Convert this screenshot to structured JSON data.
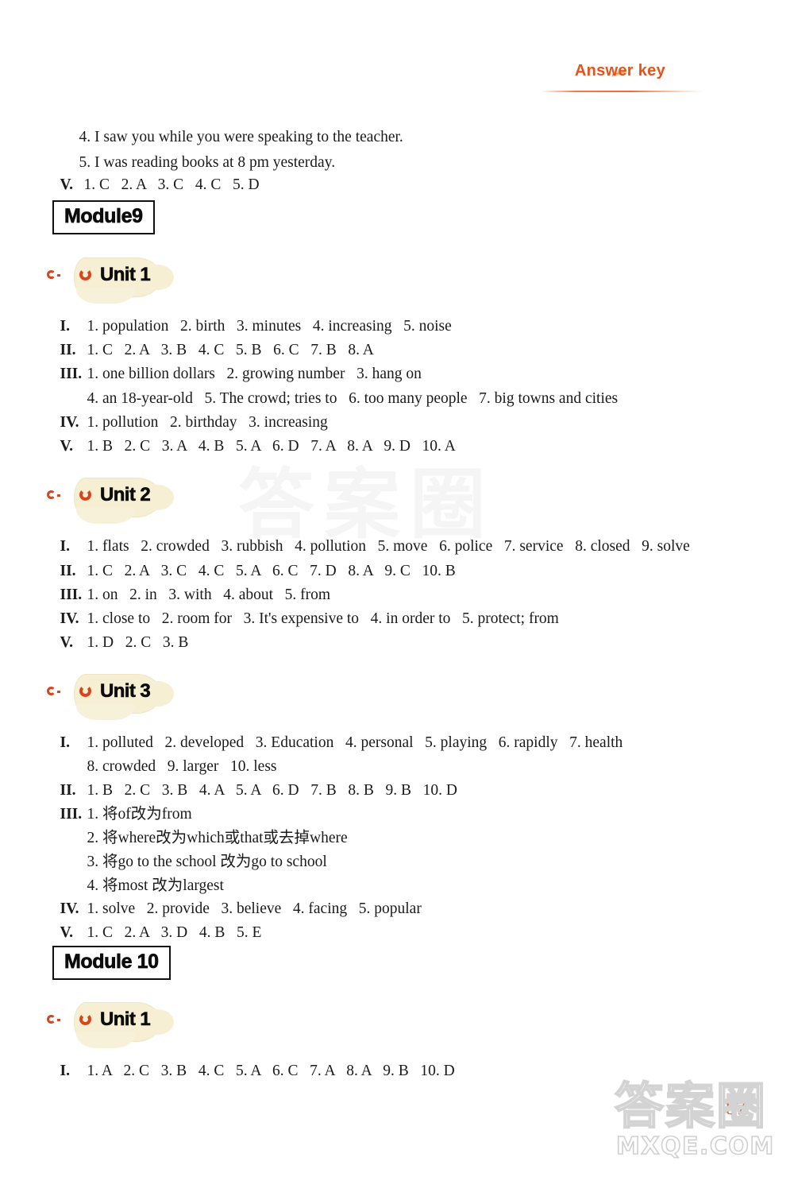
{
  "header": {
    "title": "Answer key",
    "accent_color": "#e8521a"
  },
  "page_number": "87",
  "watermark": {
    "center_text": "答案圈",
    "brand_cn": "答案圈",
    "brand_url": "MXQE.COM"
  },
  "content": {
    "intro_lines": [
      {
        "text": "4. I saw you while you were speaking to the teacher."
      },
      {
        "text": "5. I was reading books at 8 pm yesterday."
      }
    ],
    "intro_answer": {
      "roman": "V.",
      "text": "1. C   2. A   3. C   4. C   5. D"
    },
    "modules": [
      {
        "title": "Module9",
        "units": [
          {
            "label": "Unit 1",
            "rows": [
              {
                "roman": "I.",
                "text": "1. population   2. birth   3. minutes   4. increasing   5. noise"
              },
              {
                "roman": "II.",
                "text": "1. C   2. A   3. B   4. C   5. B   6. C   7. B   8. A"
              },
              {
                "roman": "III.",
                "text": "1. one billion dollars   2. growing number   3. hang on"
              },
              {
                "roman": "",
                "text": "4. an 18-year-old   5. The crowd; tries to   6. too many people   7. big towns and cities",
                "indent": true
              },
              {
                "roman": "IV.",
                "text": "1. pollution   2. birthday   3. increasing"
              },
              {
                "roman": "V.",
                "text": "1. B   2. C   3. A   4. B   5. A   6. D   7. A   8. A   9. D   10. A"
              }
            ]
          },
          {
            "label": "Unit 2",
            "rows": [
              {
                "roman": "I.",
                "text": "1. flats   2. crowded   3. rubbish   4. pollution   5. move   6. police   7. service   8. closed   9. solve"
              },
              {
                "roman": "II.",
                "text": "1. C   2. A   3. C   4. C   5. A   6. C   7. D   8. A   9. C   10. B"
              },
              {
                "roman": "III.",
                "text": "1. on   2. in   3. with   4. about   5. from"
              },
              {
                "roman": "IV.",
                "text": "1. close to   2. room for   3. It's expensive to   4. in order to   5. protect; from"
              },
              {
                "roman": "V.",
                "text": "1. D   2. C   3. B"
              }
            ]
          },
          {
            "label": "Unit 3",
            "rows": [
              {
                "roman": "I.",
                "text": "1. polluted   2. developed   3. Education   4. personal   5. playing   6. rapidly   7. health"
              },
              {
                "roman": "",
                "text": "8. crowded   9. larger   10. less",
                "indent": true
              },
              {
                "roman": "II.",
                "text": "1. B   2. C   3. B   4. A   5. A   6. D   7. B   8. B   9. B   10. D"
              },
              {
                "roman": "III.",
                "text": "1. 将of改为from"
              },
              {
                "roman": "",
                "text": "2. 将where改为which或that或去掉where",
                "indent": true
              },
              {
                "roman": "",
                "text": "3. 将go to the school 改为go to school",
                "indent": true
              },
              {
                "roman": "",
                "text": "4. 将most 改为largest",
                "indent": true
              },
              {
                "roman": "IV.",
                "text": "1. solve   2. provide   3. believe   4. facing   5. popular"
              },
              {
                "roman": "V.",
                "text": "1. C   2. A   3. D   4. B   5. E"
              }
            ]
          }
        ]
      },
      {
        "title": "Module 10",
        "units": [
          {
            "label": "Unit 1",
            "rows": [
              {
                "roman": "I.",
                "text": "1. A   2. C   3. B   4. C   5. A   6. C   7. A   8. A   9. B   10. D"
              }
            ]
          }
        ]
      }
    ]
  }
}
